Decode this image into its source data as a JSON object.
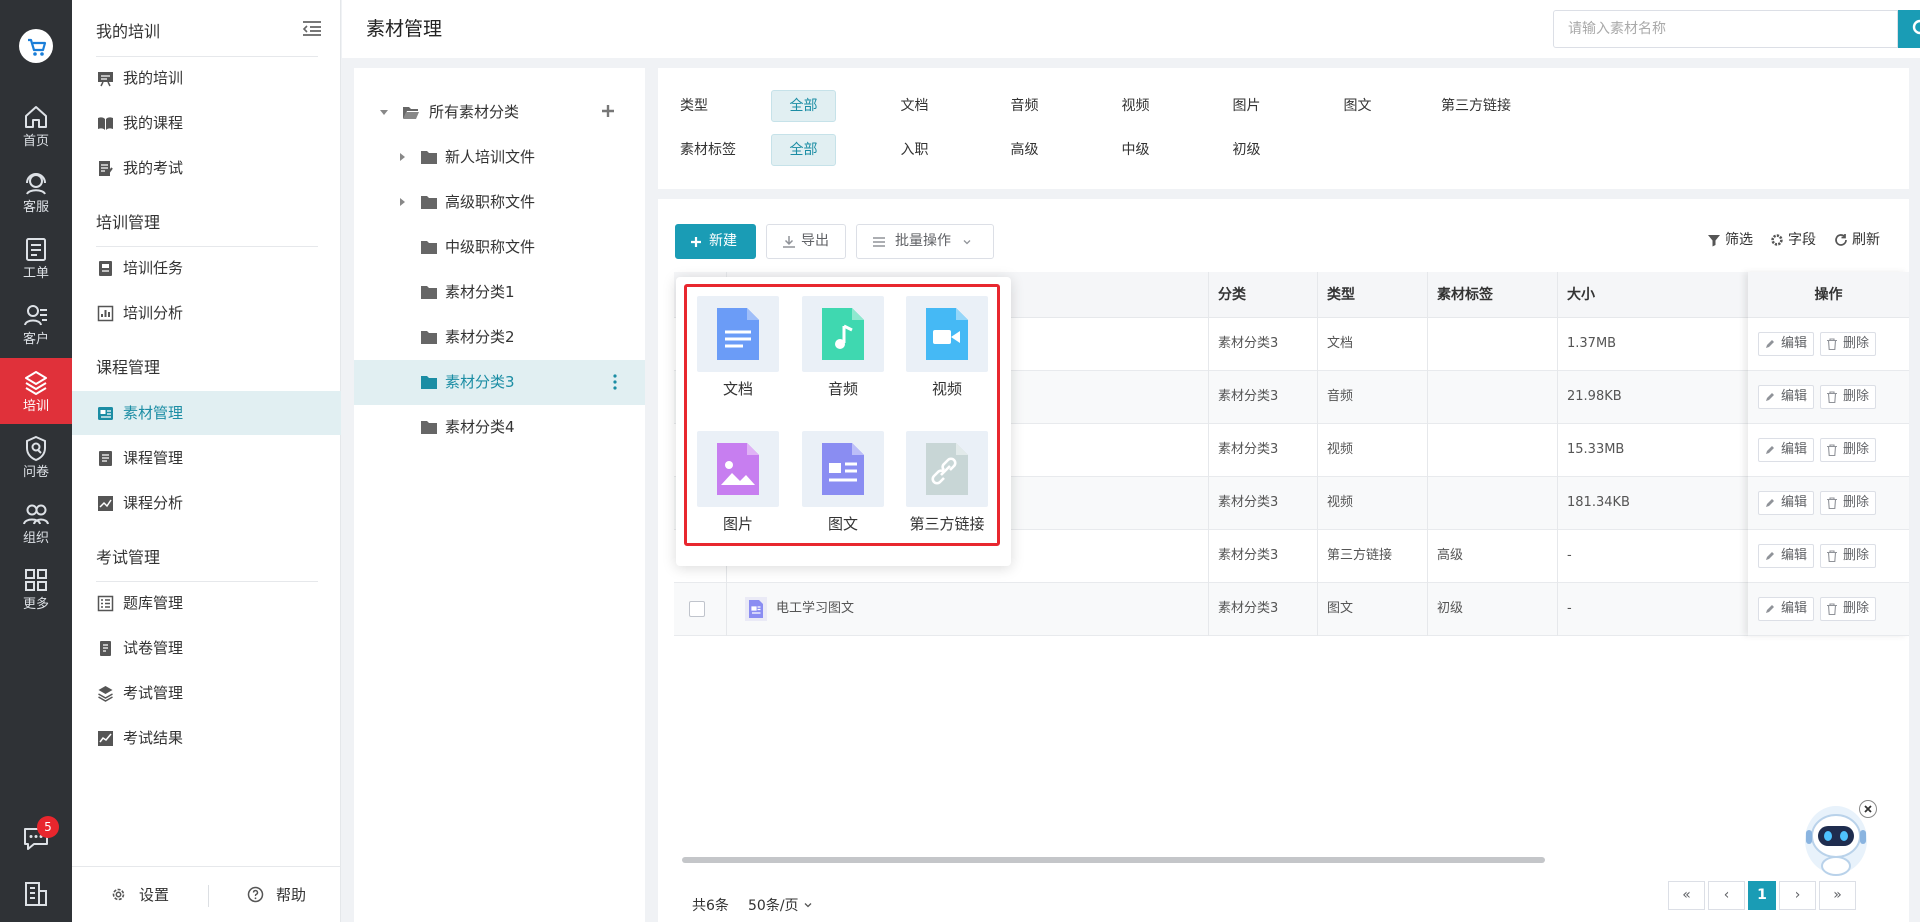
{
  "nav_rail": {
    "items": [
      {
        "label": "首页",
        "icon": "home-icon"
      },
      {
        "label": "客服",
        "icon": "headset-icon"
      },
      {
        "label": "工单",
        "icon": "clipboard-icon"
      },
      {
        "label": "客户",
        "icon": "customers-icon"
      },
      {
        "label": "培训",
        "icon": "layers-icon",
        "active": true
      },
      {
        "label": "问卷",
        "icon": "survey-shield-icon"
      },
      {
        "label": "组织",
        "icon": "organization-icon"
      },
      {
        "label": "更多",
        "icon": "grid-icon"
      }
    ],
    "chat_badge": "5"
  },
  "sidebar": {
    "title": "我的培训",
    "groups": [
      {
        "label": "我的培训",
        "items": [
          "我的培训",
          "我的课程",
          "我的考试"
        ]
      },
      {
        "label": "培训管理",
        "items": [
          "培训任务",
          "培训分析"
        ]
      },
      {
        "label": "课程管理",
        "items": [
          "素材管理",
          "课程管理",
          "课程分析"
        ]
      },
      {
        "label": "考试管理",
        "items": [
          "题库管理",
          "试卷管理",
          "考试管理",
          "考试结果"
        ]
      }
    ],
    "active_item": "素材管理",
    "settings_label": "设置",
    "help_label": "帮助"
  },
  "header": {
    "page_title": "素材管理",
    "search_placeholder": "请输入素材名称"
  },
  "tree": {
    "root": "所有素材分类",
    "nodes": [
      "新人培训文件",
      "高级职称文件",
      "中级职称文件",
      "素材分类1",
      "素材分类2",
      "素材分类3",
      "素材分类4"
    ],
    "active": "素材分类3"
  },
  "filters": {
    "type_label": "类型",
    "type_options": [
      "全部",
      "文档",
      "音频",
      "视频",
      "图片",
      "图文",
      "第三方链接"
    ],
    "tag_label": "素材标签",
    "tag_options": [
      "全部",
      "入职",
      "高级",
      "中级",
      "初级"
    ],
    "selected": "全部"
  },
  "toolbar": {
    "new_label": "新建",
    "export_label": "导出",
    "batch_label": "批量操作",
    "filter_label": "筛选",
    "fields_label": "字段",
    "refresh_label": "刷新"
  },
  "table": {
    "columns": [
      "分类",
      "类型",
      "素材标签",
      "大小",
      "操作"
    ],
    "rows": [
      {
        "name": "",
        "category": "素材分类3",
        "type": "文档",
        "tag": "",
        "size": "1.37MB"
      },
      {
        "name": "",
        "category": "素材分类3",
        "type": "音频",
        "tag": "",
        "size": "21.98KB"
      },
      {
        "name": "",
        "category": "素材分类3",
        "type": "视频",
        "tag": "",
        "size": "15.33MB"
      },
      {
        "name": "",
        "category": "素材分类3",
        "type": "视频",
        "tag": "",
        "size": "181.34KB"
      },
      {
        "name": "",
        "category": "素材分类3",
        "type": "第三方链接",
        "tag": "高级",
        "size": "-"
      },
      {
        "name": "电工学习图文",
        "category": "素材分类3",
        "type": "图文",
        "tag": "初级",
        "size": "-"
      }
    ],
    "edit_label": "编辑",
    "delete_label": "删除"
  },
  "pagination": {
    "total": "共6条",
    "page_size": "50条/页",
    "current_page": "1"
  },
  "new_menu": {
    "items": [
      {
        "label": "文档",
        "color": "#6b9cf7"
      },
      {
        "label": "音频",
        "color": "#3fd8b0"
      },
      {
        "label": "视频",
        "color": "#45b9f5"
      },
      {
        "label": "图片",
        "color": "#c77ef0"
      },
      {
        "label": "图文",
        "color": "#8a8df2"
      },
      {
        "label": "第三方链接",
        "color": "#c8d6d6"
      }
    ]
  },
  "colors": {
    "accent": "#1a9cb5",
    "rail_bg": "#2f3236",
    "rail_active": "#e0313a"
  }
}
